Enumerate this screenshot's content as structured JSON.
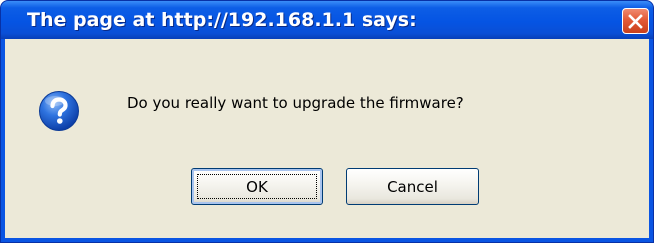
{
  "dialog": {
    "title": "The page at http://192.168.1.1 says:",
    "message": "Do you really want to upgrade the firmware?",
    "icon": "question-icon",
    "close_icon": "close-icon",
    "buttons": {
      "ok_label": "OK",
      "cancel_label": "Cancel"
    }
  },
  "colors": {
    "titlebar": "#0554e3",
    "client_background": "#ece9d8",
    "close_button": "#e35a37",
    "question_icon": "#1c5fd6"
  }
}
